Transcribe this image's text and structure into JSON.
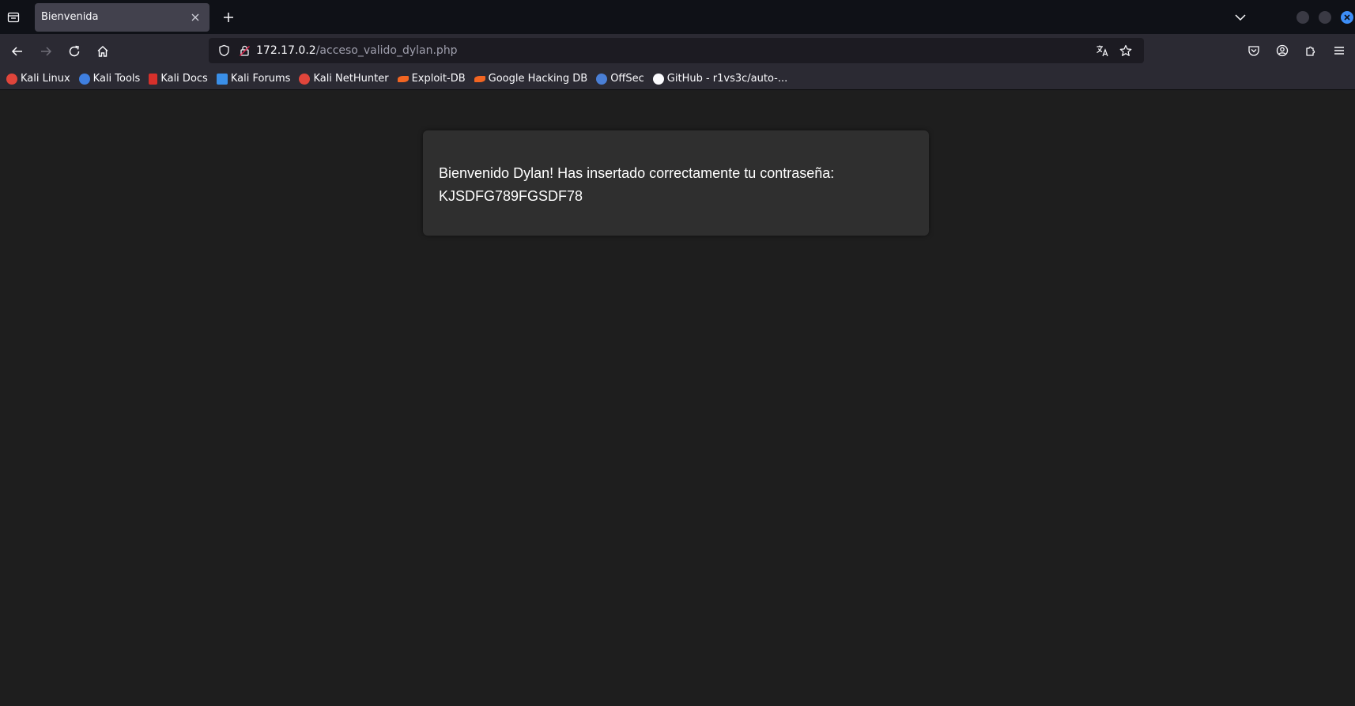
{
  "tab": {
    "title": "Bienvenida"
  },
  "url": {
    "host": "172.17.0.2",
    "path": "/acceso_valido_dylan.php"
  },
  "bookmarks": [
    {
      "label": "Kali Linux",
      "icon": "kali-dragon-icon",
      "color": "#e0453b"
    },
    {
      "label": "Kali Tools",
      "icon": "kali-tools-icon",
      "color": "#3f7fe0"
    },
    {
      "label": "Kali Docs",
      "icon": "kali-docs-icon",
      "color": "#d6302b"
    },
    {
      "label": "Kali Forums",
      "icon": "kali-forums-icon",
      "color": "#3a8fe8"
    },
    {
      "label": "Kali NetHunter",
      "icon": "kali-nethunter-icon",
      "color": "#e0453b"
    },
    {
      "label": "Exploit-DB",
      "icon": "exploit-db-icon",
      "color": "#f26522"
    },
    {
      "label": "Google Hacking DB",
      "icon": "ghdb-icon",
      "color": "#f26522"
    },
    {
      "label": "OffSec",
      "icon": "offsec-icon",
      "color": "#4a7fd6"
    },
    {
      "label": "GitHub - r1vs3c/auto-...",
      "icon": "github-icon",
      "color": "#fbfbfe"
    }
  ],
  "message": {
    "line1": "Bienvenido Dylan! Has insertado correctamente tu contraseña:",
    "line2": "KJSDFG789FGSDF78"
  }
}
